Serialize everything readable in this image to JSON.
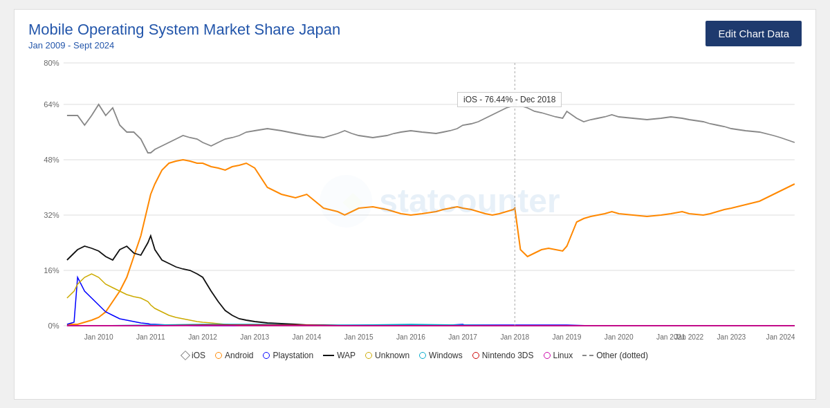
{
  "header": {
    "title": "Mobile Operating System Market Share Japan",
    "subtitle": "Jan 2009 - Sept 2024",
    "edit_button_label": "Edit Chart Data"
  },
  "tooltip": {
    "text": "iOS - 76.44% - Dec 2018"
  },
  "yaxis": {
    "labels": [
      "80%",
      "64%",
      "48%",
      "32%",
      "16%",
      "0%"
    ]
  },
  "xaxis": {
    "labels": [
      "Jan 2010",
      "Jan 2011",
      "Jan 2012",
      "Jan 2013",
      "Jan 2014",
      "Jan 2015",
      "Jan 2016",
      "Jan 2017",
      "Jan 2018",
      "Jan 2019",
      "Jan 2020",
      "Jan 2021",
      "Jan 2022",
      "Jan 2023",
      "Jan 2024"
    ]
  },
  "legend": {
    "items": [
      {
        "label": "iOS",
        "type": "diamond",
        "color": "#888888"
      },
      {
        "label": "Android",
        "type": "circle",
        "color": "#ff8800"
      },
      {
        "label": "Playstation",
        "type": "circle",
        "color": "#0000ff"
      },
      {
        "label": "WAP",
        "type": "line",
        "color": "#000000"
      },
      {
        "label": "Unknown",
        "type": "circle",
        "color": "#ccaa00"
      },
      {
        "label": "Windows",
        "type": "circle",
        "color": "#00aacc"
      },
      {
        "label": "Nintendo 3DS",
        "type": "circle",
        "color": "#cc0000"
      },
      {
        "label": "Linux",
        "type": "circle",
        "color": "#cc00aa"
      },
      {
        "label": "Other (dotted)",
        "type": "dashed",
        "color": "#888888"
      }
    ]
  },
  "colors": {
    "ios": "#888888",
    "android": "#ff8800",
    "playstation": "#0000ff",
    "wap": "#111111",
    "unknown": "#ccaa00",
    "windows": "#00aacc",
    "nintendo": "#cc0000",
    "linux": "#cc00aa",
    "other": "#888888",
    "accent": "#1e3a6e",
    "title": "#2255aa"
  }
}
